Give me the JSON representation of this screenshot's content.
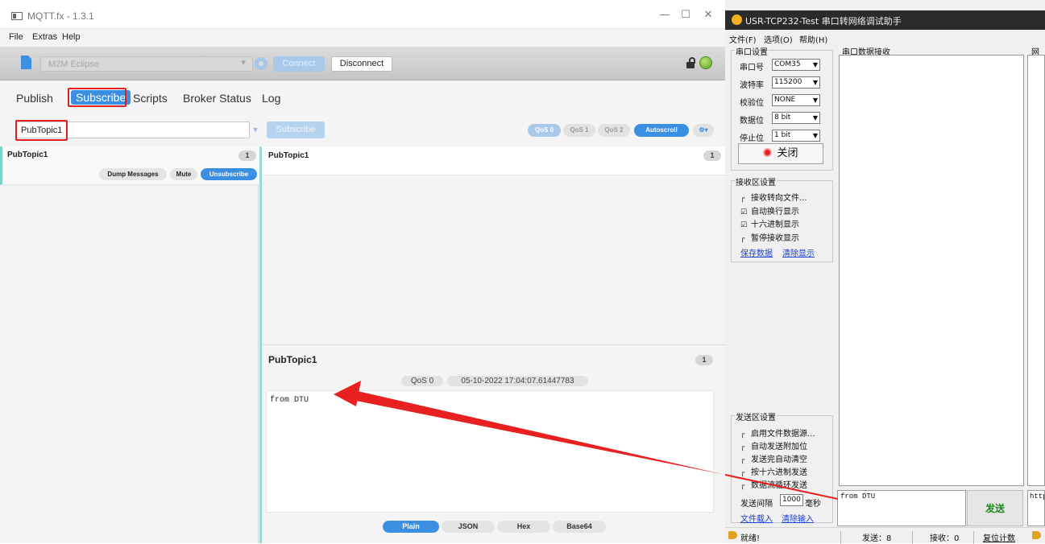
{
  "mqtt": {
    "window_title": "MQTT.fx - 1.3.1",
    "window_controls": {
      "minimize": "—",
      "maximize": "☐",
      "close": "✕"
    },
    "menu": [
      "File",
      "Extras",
      "Help"
    ],
    "connection": {
      "profile": "M2M Eclipse",
      "connect_label": "Connect",
      "disconnect_label": "Disconnect",
      "connected": true
    },
    "tabs": [
      "Publish",
      "Subscribe",
      "Scripts",
      "Broker Status",
      "Log"
    ],
    "active_tab": "Subscribe",
    "topic_input": "PubTopic1",
    "subscribe_label": "Subscribe",
    "qos_options": [
      "QoS 0",
      "QoS 1",
      "QoS 2"
    ],
    "selected_qos": "QoS 0",
    "autoscroll_label": "Autoscroll",
    "subscriptions": [
      {
        "topic": "PubTopic1",
        "count": "1",
        "dump_label": "Dump Messages",
        "mute_label": "Mute",
        "unsubscribe_label": "Unsubscribe"
      }
    ],
    "messages": [
      {
        "topic": "PubTopic1",
        "index": "1"
      }
    ],
    "detail": {
      "topic": "PubTopic1",
      "index": "1",
      "qos": "QoS 0",
      "timestamp": "05-10-2022  17:04:07.61447783",
      "payload": "from DTU",
      "formats": [
        "Plain",
        "JSON",
        "Hex",
        "Base64"
      ],
      "active_format": "Plain"
    }
  },
  "usr": {
    "window_title": "USR-TCP232-Test 串口转网络调试助手",
    "menu": [
      "文件(F)",
      "选项(O)",
      "帮助(H)"
    ],
    "serial_settings": {
      "title": "串口设置",
      "port_label": "串口号",
      "port": "COM35",
      "baud_label": "波特率",
      "baud": "115200",
      "parity_label": "校验位",
      "parity": "NONE",
      "databits_label": "数据位",
      "databits": "8 bit",
      "stopbits_label": "停止位",
      "stopbits": "1 bit",
      "close_label": "关闭"
    },
    "serial_recv_title": "串口数据接收",
    "net_title": "网络",
    "recv_settings": {
      "title": "接收区设置",
      "options": [
        {
          "label": "接收转向文件...",
          "checked": false
        },
        {
          "label": "自动换行显示",
          "checked": true
        },
        {
          "label": "十六进制显示",
          "checked": true
        },
        {
          "label": "暂停接收显示",
          "checked": false
        }
      ],
      "save_link": "保存数据",
      "clear_link": "清除显示"
    },
    "send_settings": {
      "title": "发送区设置",
      "options": [
        {
          "label": "启用文件数据源...",
          "checked": false
        },
        {
          "label": "自动发送附加位",
          "checked": false
        },
        {
          "label": "发送完自动清空",
          "checked": false
        },
        {
          "label": "按十六进制发送",
          "checked": false
        },
        {
          "label": "数据流循环发送",
          "checked": false
        }
      ],
      "interval_label": "发送间隔",
      "interval": "1000",
      "interval_unit": "毫秒",
      "load_file_link": "文件载入",
      "clear_input_link": "清除输入"
    },
    "send_text": "from DTU",
    "send_button": "发送",
    "net_send_text": "http",
    "status": {
      "ready": "就绪!",
      "sent": "发送：8",
      "received": "接收：0",
      "reset": "复位计数"
    }
  },
  "colors": {
    "accent_blue": "#3a8fe2",
    "highlight_red": "#e02020",
    "connected_green": "#5ea61e"
  }
}
